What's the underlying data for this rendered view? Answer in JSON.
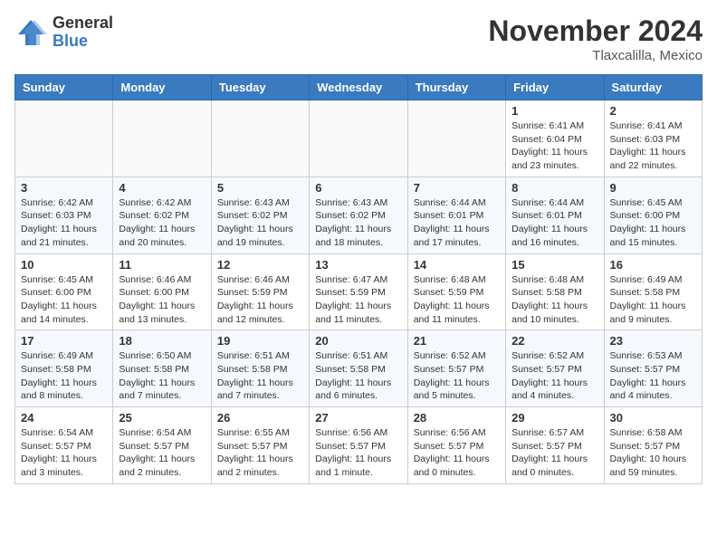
{
  "header": {
    "logo_general": "General",
    "logo_blue": "Blue",
    "month_title": "November 2024",
    "location": "Tlaxcalilla, Mexico"
  },
  "days_of_week": [
    "Sunday",
    "Monday",
    "Tuesday",
    "Wednesday",
    "Thursday",
    "Friday",
    "Saturday"
  ],
  "weeks": [
    [
      {
        "day": "",
        "info": ""
      },
      {
        "day": "",
        "info": ""
      },
      {
        "day": "",
        "info": ""
      },
      {
        "day": "",
        "info": ""
      },
      {
        "day": "",
        "info": ""
      },
      {
        "day": "1",
        "info": "Sunrise: 6:41 AM\nSunset: 6:04 PM\nDaylight: 11 hours and 23 minutes."
      },
      {
        "day": "2",
        "info": "Sunrise: 6:41 AM\nSunset: 6:03 PM\nDaylight: 11 hours and 22 minutes."
      }
    ],
    [
      {
        "day": "3",
        "info": "Sunrise: 6:42 AM\nSunset: 6:03 PM\nDaylight: 11 hours and 21 minutes."
      },
      {
        "day": "4",
        "info": "Sunrise: 6:42 AM\nSunset: 6:02 PM\nDaylight: 11 hours and 20 minutes."
      },
      {
        "day": "5",
        "info": "Sunrise: 6:43 AM\nSunset: 6:02 PM\nDaylight: 11 hours and 19 minutes."
      },
      {
        "day": "6",
        "info": "Sunrise: 6:43 AM\nSunset: 6:02 PM\nDaylight: 11 hours and 18 minutes."
      },
      {
        "day": "7",
        "info": "Sunrise: 6:44 AM\nSunset: 6:01 PM\nDaylight: 11 hours and 17 minutes."
      },
      {
        "day": "8",
        "info": "Sunrise: 6:44 AM\nSunset: 6:01 PM\nDaylight: 11 hours and 16 minutes."
      },
      {
        "day": "9",
        "info": "Sunrise: 6:45 AM\nSunset: 6:00 PM\nDaylight: 11 hours and 15 minutes."
      }
    ],
    [
      {
        "day": "10",
        "info": "Sunrise: 6:45 AM\nSunset: 6:00 PM\nDaylight: 11 hours and 14 minutes."
      },
      {
        "day": "11",
        "info": "Sunrise: 6:46 AM\nSunset: 6:00 PM\nDaylight: 11 hours and 13 minutes."
      },
      {
        "day": "12",
        "info": "Sunrise: 6:46 AM\nSunset: 5:59 PM\nDaylight: 11 hours and 12 minutes."
      },
      {
        "day": "13",
        "info": "Sunrise: 6:47 AM\nSunset: 5:59 PM\nDaylight: 11 hours and 11 minutes."
      },
      {
        "day": "14",
        "info": "Sunrise: 6:48 AM\nSunset: 5:59 PM\nDaylight: 11 hours and 11 minutes."
      },
      {
        "day": "15",
        "info": "Sunrise: 6:48 AM\nSunset: 5:58 PM\nDaylight: 11 hours and 10 minutes."
      },
      {
        "day": "16",
        "info": "Sunrise: 6:49 AM\nSunset: 5:58 PM\nDaylight: 11 hours and 9 minutes."
      }
    ],
    [
      {
        "day": "17",
        "info": "Sunrise: 6:49 AM\nSunset: 5:58 PM\nDaylight: 11 hours and 8 minutes."
      },
      {
        "day": "18",
        "info": "Sunrise: 6:50 AM\nSunset: 5:58 PM\nDaylight: 11 hours and 7 minutes."
      },
      {
        "day": "19",
        "info": "Sunrise: 6:51 AM\nSunset: 5:58 PM\nDaylight: 11 hours and 7 minutes."
      },
      {
        "day": "20",
        "info": "Sunrise: 6:51 AM\nSunset: 5:58 PM\nDaylight: 11 hours and 6 minutes."
      },
      {
        "day": "21",
        "info": "Sunrise: 6:52 AM\nSunset: 5:57 PM\nDaylight: 11 hours and 5 minutes."
      },
      {
        "day": "22",
        "info": "Sunrise: 6:52 AM\nSunset: 5:57 PM\nDaylight: 11 hours and 4 minutes."
      },
      {
        "day": "23",
        "info": "Sunrise: 6:53 AM\nSunset: 5:57 PM\nDaylight: 11 hours and 4 minutes."
      }
    ],
    [
      {
        "day": "24",
        "info": "Sunrise: 6:54 AM\nSunset: 5:57 PM\nDaylight: 11 hours and 3 minutes."
      },
      {
        "day": "25",
        "info": "Sunrise: 6:54 AM\nSunset: 5:57 PM\nDaylight: 11 hours and 2 minutes."
      },
      {
        "day": "26",
        "info": "Sunrise: 6:55 AM\nSunset: 5:57 PM\nDaylight: 11 hours and 2 minutes."
      },
      {
        "day": "27",
        "info": "Sunrise: 6:56 AM\nSunset: 5:57 PM\nDaylight: 11 hours and 1 minute."
      },
      {
        "day": "28",
        "info": "Sunrise: 6:56 AM\nSunset: 5:57 PM\nDaylight: 11 hours and 0 minutes."
      },
      {
        "day": "29",
        "info": "Sunrise: 6:57 AM\nSunset: 5:57 PM\nDaylight: 11 hours and 0 minutes."
      },
      {
        "day": "30",
        "info": "Sunrise: 6:58 AM\nSunset: 5:57 PM\nDaylight: 10 hours and 59 minutes."
      }
    ]
  ]
}
